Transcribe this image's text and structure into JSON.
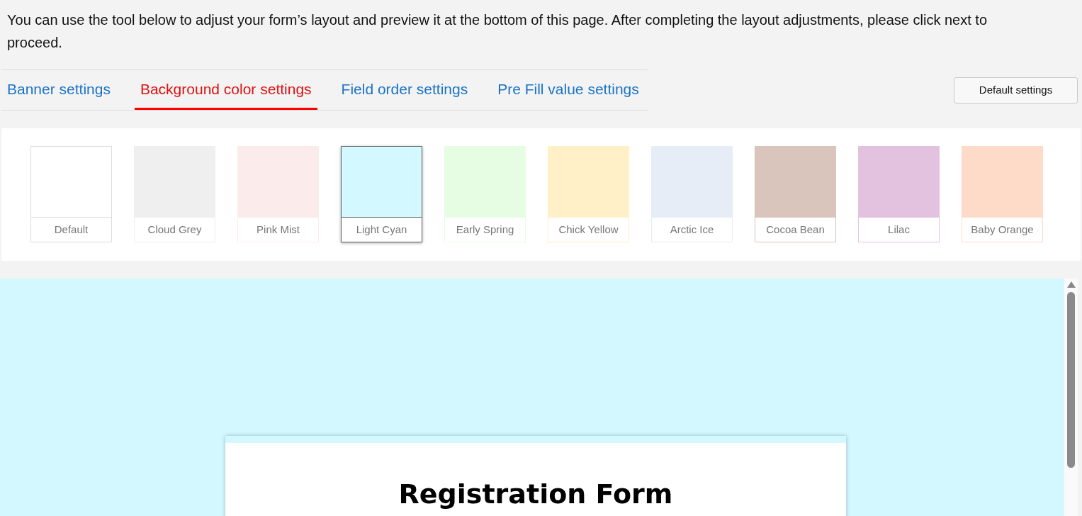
{
  "intro": "You can use the tool below to adjust your form’s layout and preview it at the bottom of this page. After completing the layout adjustments, please click next to proceed.",
  "tabs": [
    {
      "label": "Banner settings",
      "selected": false
    },
    {
      "label": "Background color settings",
      "selected": true
    },
    {
      "label": "Field order settings",
      "selected": false
    },
    {
      "label": "Pre Fill value settings",
      "selected": false
    }
  ],
  "default_button": "Default settings",
  "swatches": [
    {
      "label": "Default",
      "color": "#ffffff",
      "selected": false
    },
    {
      "label": "Cloud Grey",
      "color": "#efefef",
      "selected": false
    },
    {
      "label": "Pink Mist",
      "color": "#fcebeb",
      "selected": false
    },
    {
      "label": "Light Cyan",
      "color": "#d3f8ff",
      "selected": true
    },
    {
      "label": "Early Spring",
      "color": "#e6fde3",
      "selected": false
    },
    {
      "label": "Chick Yellow",
      "color": "#fff0c8",
      "selected": false
    },
    {
      "label": "Arctic Ice",
      "color": "#e6edf7",
      "selected": false
    },
    {
      "label": "Cocoa Bean",
      "color": "#d9c5bb",
      "selected": false
    },
    {
      "label": "Lilac",
      "color": "#e2c2df",
      "selected": false
    },
    {
      "label": "Baby Orange",
      "color": "#fedac8",
      "selected": false
    }
  ],
  "preview": {
    "form_title": "Registration Form"
  }
}
